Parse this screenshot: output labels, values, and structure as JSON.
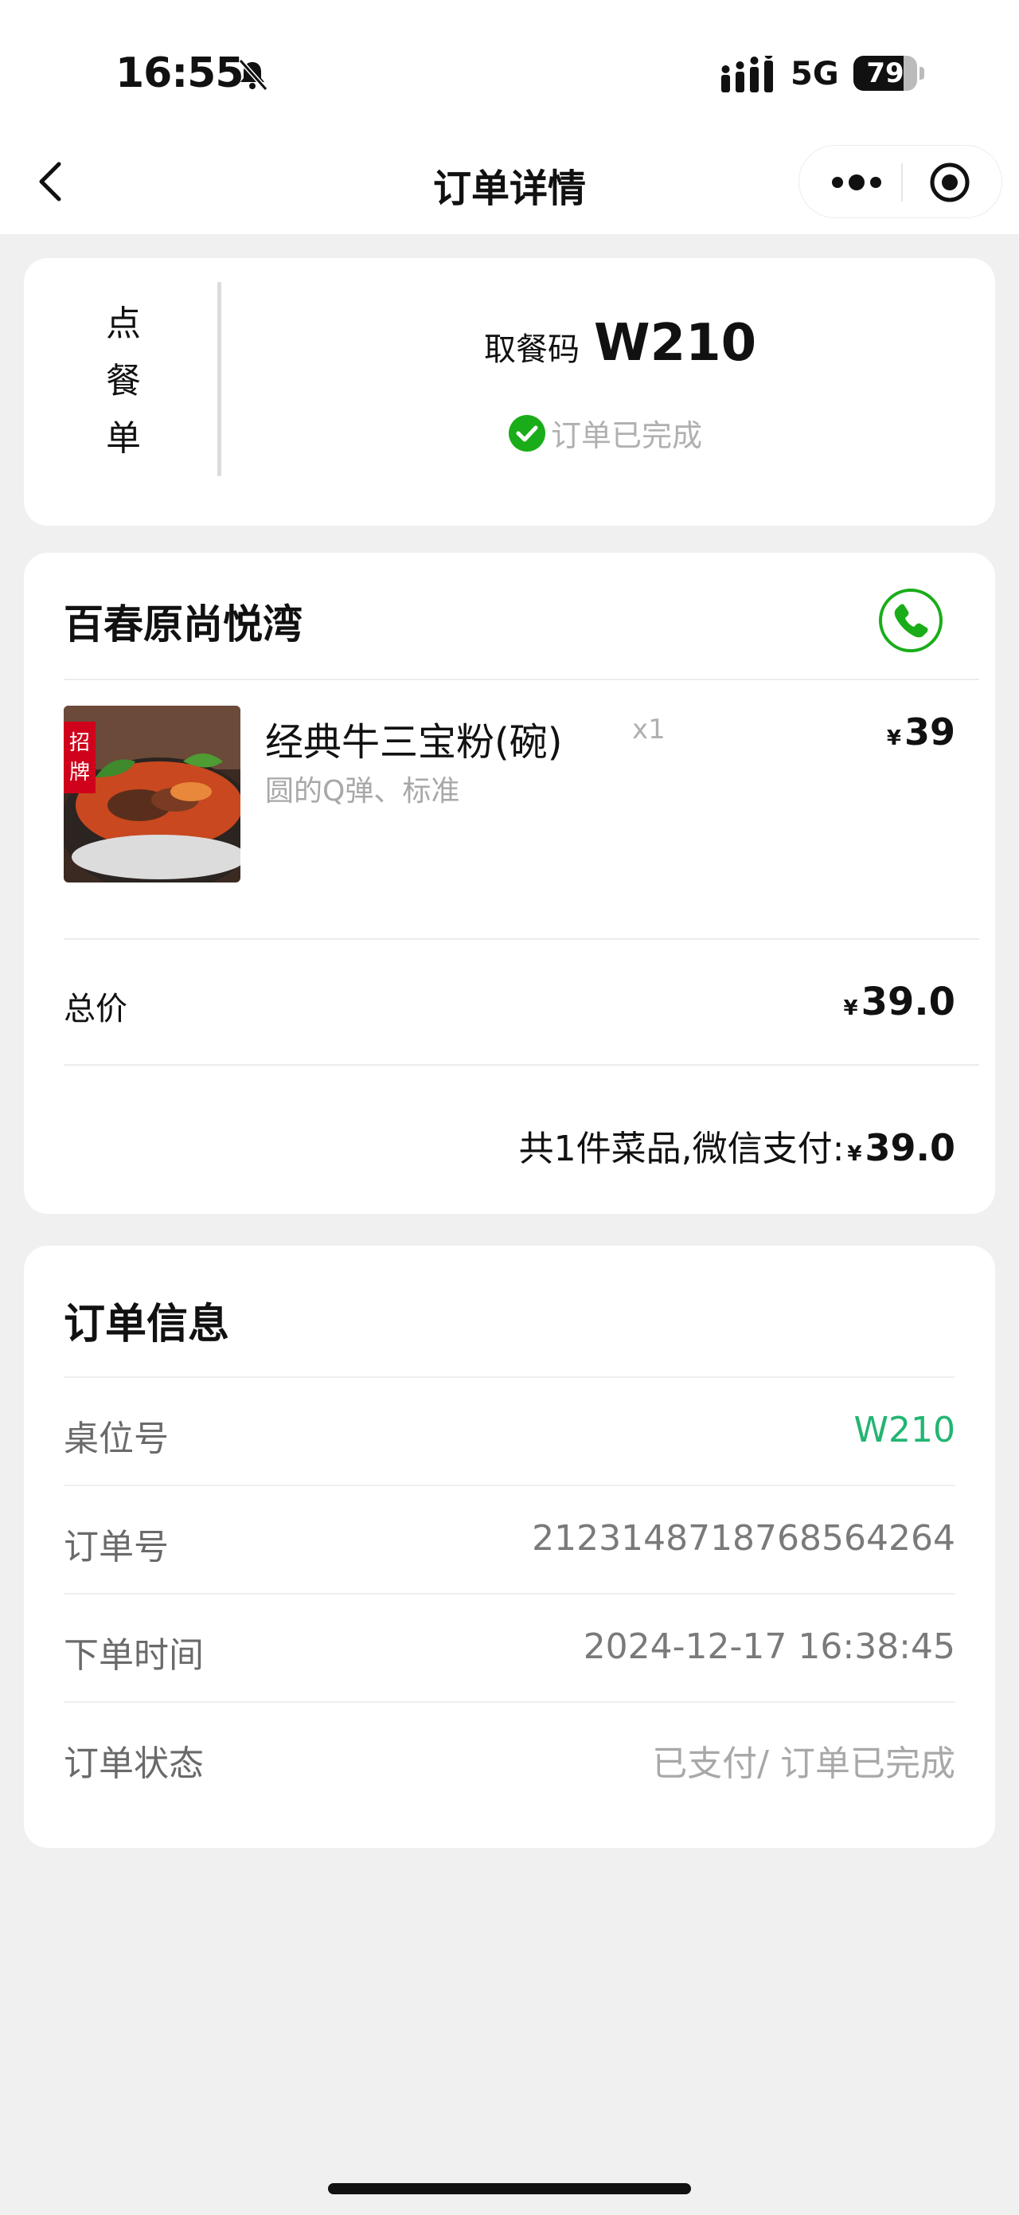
{
  "status_bar": {
    "time": "16:55",
    "network": "5G",
    "battery_level": "79",
    "battery_fraction": 0.79,
    "icons": [
      "bell-mute-icon",
      "signal-icon",
      "battery-icon"
    ]
  },
  "nav": {
    "title": "订单详情",
    "icons": [
      "back-chevron-icon",
      "more-dots-icon",
      "target-icon"
    ]
  },
  "pickup_card": {
    "vertical_label": [
      "点",
      "餐",
      "单"
    ],
    "pickup_label": "取餐码",
    "pickup_code": "W210",
    "status": "订单已完成"
  },
  "shop": {
    "name": "百春原尚悦湾",
    "items": [
      {
        "image_badge": "招牌",
        "name": "经典牛三宝粉(碗)",
        "qty": "x1",
        "spec": "圆的Q弹、标准",
        "currency": "¥",
        "price": "39"
      }
    ],
    "total_label": "总价",
    "total_currency": "¥",
    "total": "39.0",
    "summary_text": "共1件菜品,微信支付:",
    "summary_currency": "¥",
    "summary_amount": "39.0"
  },
  "order_info": {
    "title": "订单信息",
    "rows": [
      {
        "label": "桌位号",
        "value": "W210"
      },
      {
        "label": "订单号",
        "value": "2123148718768564264"
      },
      {
        "label": "下单时间",
        "value": "2024-12-17 16:38:45"
      },
      {
        "label": "订单状态",
        "value": "已支付/ 订单已完成"
      }
    ]
  },
  "colors": {
    "accent_green": "#22b573",
    "check_green": "#1aad19",
    "background": "#f0f0f0"
  }
}
